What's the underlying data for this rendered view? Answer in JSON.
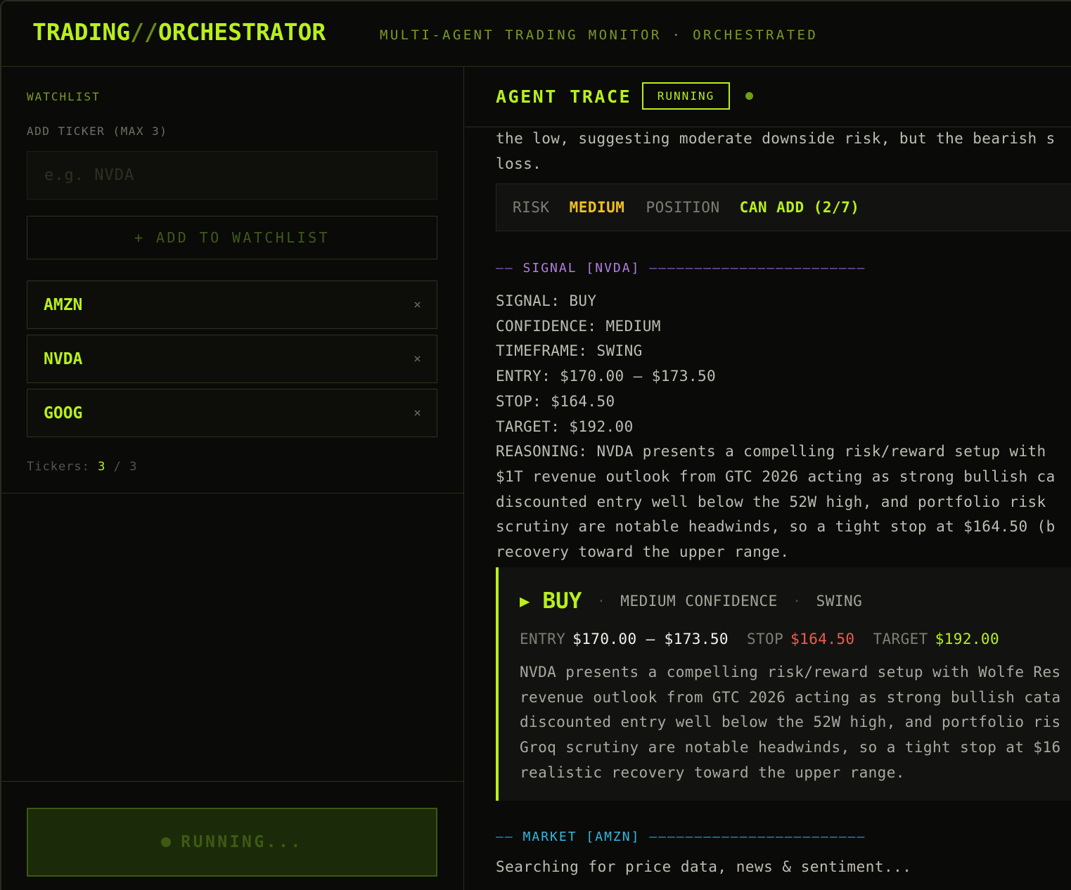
{
  "header": {
    "logo_part1": "TRADING",
    "logo_slash": "//",
    "logo_part2": "ORCHESTRATOR",
    "subtitle": "MULTI-AGENT TRADING MONITOR · ORCHESTRATED"
  },
  "sidebar": {
    "section_label": "WATCHLIST",
    "field_label": "ADD TICKER (MAX 3)",
    "input_placeholder": "e.g. NVDA",
    "input_value": "",
    "add_button": "+ ADD TO WATCHLIST",
    "watchlist": [
      {
        "symbol": "AMZN",
        "remove": "×"
      },
      {
        "symbol": "NVDA",
        "remove": "×"
      },
      {
        "symbol": "GOOG",
        "remove": "×"
      }
    ],
    "count_label": "Tickers: ",
    "count_current": "3",
    "count_sep": " / ",
    "count_max": "3",
    "run_button": "RUNNING..."
  },
  "trace": {
    "title": "AGENT TRACE",
    "status_badge": "RUNNING",
    "prev_lines": [
      "the low, suggesting moderate downside risk, but the bearish s",
      "loss."
    ],
    "risk": {
      "risk_label": "RISK",
      "risk_value": "MEDIUM",
      "position_label": "POSITION",
      "position_value": "CAN ADD (2/7)"
    },
    "signal_section": {
      "dash_prefix": "——",
      "label": "SIGNAL [NVDA]",
      "dash_suffix": "————————————————————————"
    },
    "signal_lines": [
      "SIGNAL: BUY",
      "CONFIDENCE: MEDIUM",
      "TIMEFRAME: SWING",
      "ENTRY: $170.00 – $173.50",
      "STOP: $164.50",
      "TARGET: $192.00",
      "REASONING: NVDA presents a compelling risk/reward setup with",
      "$1T revenue outlook from GTC 2026 acting as strong bullish ca",
      "discounted entry well below the 52W high, and portfolio risk",
      "scrutiny are notable headwinds, so a tight stop at $164.50 (b",
      "recovery toward the upper range."
    ],
    "card": {
      "triangle": "▶",
      "action": "BUY",
      "bullet": "·",
      "confidence": "MEDIUM CONFIDENCE",
      "timeframe": "SWING",
      "entry_label": "ENTRY",
      "entry_value": "$170.00 – $173.50",
      "stop_label": "STOP",
      "stop_value": "$164.50",
      "target_label": "TARGET",
      "target_value": "$192.00",
      "text_lines": [
        "NVDA presents a compelling risk/reward setup with Wolfe Res",
        "revenue outlook from GTC 2026 acting as strong bullish cata",
        "discounted entry well below the 52W high, and portfolio ris",
        "Groq scrutiny are notable headwinds, so a tight stop at $16",
        "realistic recovery toward the upper range."
      ]
    },
    "market_section": {
      "dash_prefix": "——",
      "label": "MARKET [AMZN]",
      "dash_suffix": "————————————————————————"
    },
    "market_status": "Searching for price data, news & sentiment..."
  },
  "colors": {
    "accent": "#b8f01a",
    "warning": "#f0c020",
    "danger": "#f05a50",
    "signal_purple": "#b27fe6",
    "market_cyan": "#34b8e0",
    "background": "#0a0a08"
  }
}
